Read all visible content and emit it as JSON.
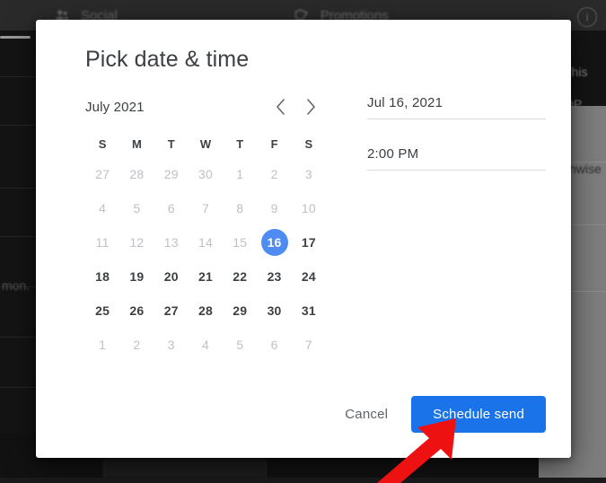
{
  "background": {
    "tabs": [
      {
        "label": "Social",
        "icon": "people-icon"
      },
      {
        "label": "Promotions",
        "icon": "tag-icon"
      }
    ],
    "info_icon": "info-icon",
    "text_fragments": {
      "left": "mon.",
      "right_1": "This",
      "right_2": "OP",
      "right_3": "chwise",
      "right_4": "P"
    }
  },
  "dialog": {
    "title": "Pick date & time",
    "calendar": {
      "month_label": "July 2021",
      "prev_label": "‹",
      "next_label": "›",
      "weekdays": [
        "S",
        "M",
        "T",
        "W",
        "T",
        "F",
        "S"
      ],
      "selected_day": 16,
      "weeks": [
        [
          {
            "n": 27,
            "muted": true
          },
          {
            "n": 28,
            "muted": true
          },
          {
            "n": 29,
            "muted": true
          },
          {
            "n": 30,
            "muted": true
          },
          {
            "n": 1,
            "muted": true
          },
          {
            "n": 2,
            "muted": true
          },
          {
            "n": 3,
            "muted": true
          }
        ],
        [
          {
            "n": 4,
            "muted": true
          },
          {
            "n": 5,
            "muted": true
          },
          {
            "n": 6,
            "muted": true
          },
          {
            "n": 7,
            "muted": true
          },
          {
            "n": 8,
            "muted": true
          },
          {
            "n": 9,
            "muted": true
          },
          {
            "n": 10,
            "muted": true
          }
        ],
        [
          {
            "n": 11,
            "muted": true
          },
          {
            "n": 12,
            "muted": true
          },
          {
            "n": 13,
            "muted": true
          },
          {
            "n": 14,
            "muted": true
          },
          {
            "n": 15,
            "muted": true
          },
          {
            "n": 16,
            "muted": false,
            "selected": true
          },
          {
            "n": 17,
            "muted": false
          }
        ],
        [
          {
            "n": 18,
            "muted": false
          },
          {
            "n": 19,
            "muted": false
          },
          {
            "n": 20,
            "muted": false
          },
          {
            "n": 21,
            "muted": false
          },
          {
            "n": 22,
            "muted": false
          },
          {
            "n": 23,
            "muted": false
          },
          {
            "n": 24,
            "muted": false
          }
        ],
        [
          {
            "n": 25,
            "muted": false
          },
          {
            "n": 26,
            "muted": false
          },
          {
            "n": 27,
            "muted": false
          },
          {
            "n": 28,
            "muted": false
          },
          {
            "n": 29,
            "muted": false
          },
          {
            "n": 30,
            "muted": false
          },
          {
            "n": 31,
            "muted": false
          }
        ],
        [
          {
            "n": 1,
            "muted": true
          },
          {
            "n": 2,
            "muted": true
          },
          {
            "n": 3,
            "muted": true
          },
          {
            "n": 4,
            "muted": true
          },
          {
            "n": 5,
            "muted": true
          },
          {
            "n": 6,
            "muted": true
          },
          {
            "n": 7,
            "muted": true
          }
        ]
      ]
    },
    "fields": {
      "date_value": "Jul 16, 2021",
      "time_value": "2:00 PM"
    },
    "actions": {
      "cancel_label": "Cancel",
      "primary_label": "Schedule send"
    }
  },
  "annotation": {
    "arrow": "red-arrow-pointing-to-schedule-send",
    "color": "#ee1111"
  },
  "colors": {
    "primary_blue": "#1a73e8",
    "selected_day_blue": "#4e8cf4",
    "text_primary": "#3c4043",
    "text_muted": "#bdc1c6",
    "divider": "#dadce0"
  }
}
